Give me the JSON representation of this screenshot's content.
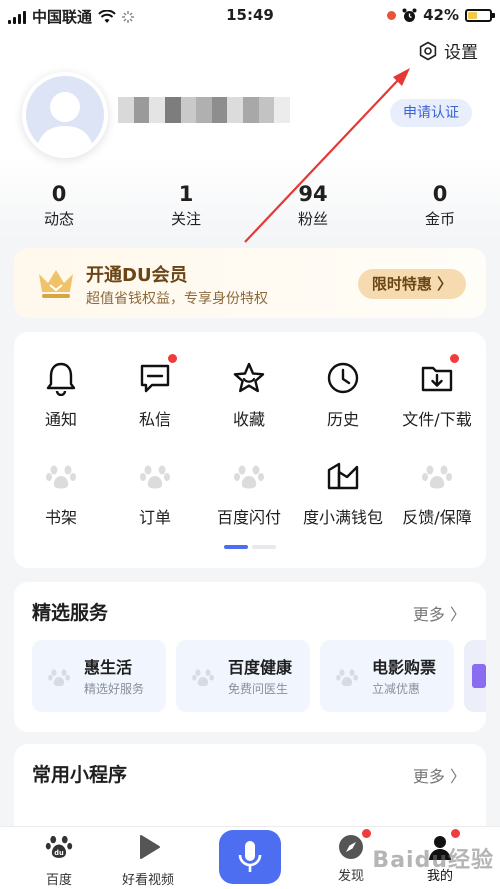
{
  "status_bar": {
    "carrier": "中国联通",
    "time": "15:49",
    "battery": "42%",
    "battery_level": 0.42
  },
  "header": {
    "settings_label": "设置",
    "auth_label": "申请认证"
  },
  "stats": [
    {
      "num": "0",
      "label": "动态"
    },
    {
      "num": "1",
      "label": "关注"
    },
    {
      "num": "94",
      "label": "粉丝"
    },
    {
      "num": "0",
      "label": "金币"
    }
  ],
  "vip": {
    "title": "开通DU会员",
    "subtitle": "超值省钱权益，专享身份特权",
    "button": "限时特惠 〉"
  },
  "grid": [
    {
      "label": "通知",
      "icon": "bell-icon",
      "dot": false
    },
    {
      "label": "私信",
      "icon": "message-icon",
      "dot": true
    },
    {
      "label": "收藏",
      "icon": "star-icon",
      "dot": false
    },
    {
      "label": "历史",
      "icon": "clock-icon",
      "dot": false
    },
    {
      "label": "文件/下载",
      "icon": "download-folder-icon",
      "dot": true
    },
    {
      "label": "书架",
      "icon": "paw-icon",
      "dot": false
    },
    {
      "label": "订单",
      "icon": "paw-icon",
      "dot": false
    },
    {
      "label": "百度闪付",
      "icon": "paw-icon",
      "dot": false
    },
    {
      "label": "度小满钱包",
      "icon": "wallet-icon",
      "dot": false
    },
    {
      "label": "反馈/保障",
      "icon": "paw-icon",
      "dot": false
    }
  ],
  "services": {
    "title": "精选服务",
    "more": "更多 〉",
    "items": [
      {
        "title": "惠生活",
        "subtitle": "精选好服务"
      },
      {
        "title": "百度健康",
        "subtitle": "免费问医生"
      },
      {
        "title": "电影购票",
        "subtitle": "立减优惠"
      }
    ]
  },
  "mini_programs": {
    "title": "常用小程序",
    "more": "更多 〉"
  },
  "bottom_nav": {
    "items": [
      {
        "label": "百度"
      },
      {
        "label": "好看视频"
      },
      {
        "label": "发现"
      },
      {
        "label": "我的"
      }
    ]
  },
  "colors": {
    "accent_blue": "#4e6ef2",
    "red_dot": "#ef3b3b",
    "vip_gold": "#6a4516",
    "annotation_arrow": "#e53935"
  },
  "watermark": "Baidu经验"
}
